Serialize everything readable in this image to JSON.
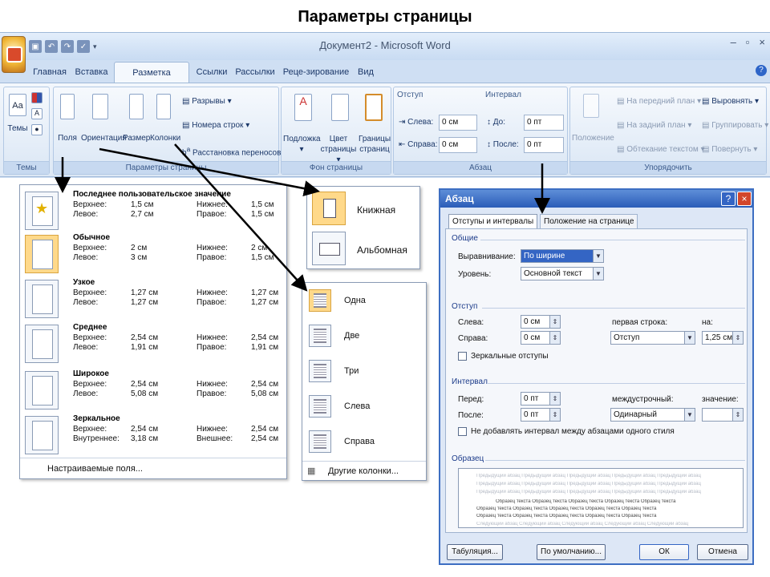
{
  "slide": {
    "title": "Параметры страницы"
  },
  "window": {
    "title": "Документ2 - Microsoft Word",
    "controls": {
      "minimize": "–",
      "restore": "▫",
      "close": "×"
    },
    "tabs": [
      "Главная",
      "Вставка",
      "Разметка страницы",
      "Ссылки",
      "Рассылки",
      "Реце-зирование",
      "Вид"
    ],
    "active_tab": "Разметка страницы",
    "help": "?"
  },
  "ribbon": {
    "themes": {
      "label": "Темы",
      "button": "Темы",
      "icon_text": "Aa"
    },
    "page_setup": {
      "label": "Параметры страницы",
      "buttons": [
        "Поля",
        "Ориентация",
        "Размер",
        "Колонки"
      ],
      "small": [
        "Разрывы",
        "Номера строк",
        "Расстановка переносов"
      ]
    },
    "page_background": {
      "label": "Фон страницы",
      "buttons": [
        "Подложка",
        "Цвет страницы",
        "Границы страниц"
      ],
      "first_word": [
        "Подложка",
        "Цвет",
        "Границы"
      ],
      "second_word": [
        "",
        "страницы",
        "страниц"
      ]
    },
    "paragraph": {
      "label": "Абзац",
      "indent_title": "Отступ",
      "spacing_title": "Интервал",
      "left_label": "Слева:",
      "right_label": "Справа:",
      "before_label": "До:",
      "after_label": "После:",
      "left_value": "0 см",
      "right_value": "0 см",
      "before_value": "0 пт",
      "after_value": "0 пт"
    },
    "arrange": {
      "label": "Упорядочить",
      "position": "Положение",
      "items": [
        "На передний план",
        "На задний план",
        "Обтекание текстом",
        "Выровнять",
        "Группировать",
        "Повернуть"
      ]
    }
  },
  "margins_menu": {
    "items": [
      {
        "name": "Последнее пользовательское значение",
        "top_label": "Верхнее:",
        "top": "1,5 см",
        "bottom_label": "Нижнее:",
        "bottom": "1,5 см",
        "left_label": "Левое:",
        "left": "2,7 см",
        "right_label": "Правое:",
        "right": "1,5 см"
      },
      {
        "name": "Обычное",
        "top_label": "Верхнее:",
        "top": "2 см",
        "bottom_label": "Нижнее:",
        "bottom": "2 см",
        "left_label": "Левое:",
        "left": "3 см",
        "right_label": "Правое:",
        "right": "1,5 см"
      },
      {
        "name": "Узкое",
        "top_label": "Верхнее:",
        "top": "1,27 см",
        "bottom_label": "Нижнее:",
        "bottom": "1,27 см",
        "left_label": "Левое:",
        "left": "1,27 см",
        "right_label": "Правое:",
        "right": "1,27 см"
      },
      {
        "name": "Среднее",
        "top_label": "Верхнее:",
        "top": "2,54 см",
        "bottom_label": "Нижнее:",
        "bottom": "2,54 см",
        "left_label": "Левое:",
        "left": "1,91 см",
        "right_label": "Правое:",
        "right": "1,91 см"
      },
      {
        "name": "Широкое",
        "top_label": "Верхнее:",
        "top": "2,54 см",
        "bottom_label": "Нижнее:",
        "bottom": "2,54 см",
        "left_label": "Левое:",
        "left": "5,08 см",
        "right_label": "Правое:",
        "right": "5,08 см"
      },
      {
        "name": "Зеркальное",
        "top_label": "Верхнее:",
        "top": "2,54 см",
        "bottom_label": "Нижнее:",
        "bottom": "2,54 см",
        "left_label": "Внутреннее:",
        "left": "3,18 см",
        "right_label": "Внешнее:",
        "right": "2,54 см"
      }
    ],
    "custom": "Настраиваемые поля..."
  },
  "orientation_menu": {
    "items": [
      "Книжная",
      "Альбомная"
    ]
  },
  "columns_menu": {
    "items": [
      "Одна",
      "Две",
      "Три",
      "Слева",
      "Справа"
    ],
    "more": "Другие колонки..."
  },
  "dialog": {
    "title": "Абзац",
    "help": "?",
    "close": "×",
    "tabs": [
      "Отступы и интервалы",
      "Положение на странице"
    ],
    "general": {
      "title": "Общие",
      "alignment_label": "Выравнивание:",
      "alignment_value": "По ширине",
      "level_label": "Уровень:",
      "level_value": "Основной текст"
    },
    "indent": {
      "title": "Отступ",
      "left_label": "Слева:",
      "left_value": "0 см",
      "right_label": "Справа:",
      "right_value": "0 см",
      "first_line_label": "первая строка:",
      "first_line_value": "Отступ",
      "by_label": "на:",
      "by_value": "1,25 см",
      "mirror_label": "Зеркальные отступы"
    },
    "spacing": {
      "title": "Интервал",
      "before_label": "Перед:",
      "before_value": "0 пт",
      "after_label": "После:",
      "after_value": "0 пт",
      "line_label": "междустрочный:",
      "line_value": "Одинарный",
      "value_label": "значение:",
      "value_value": "",
      "no_space_label": "Не добавлять интервал между абзацами одного стиля"
    },
    "sample": {
      "title": "Образец",
      "prev_text": "Предыдущий абзац Предыдущий абзац Предыдущий абзац Предыдущий абзац Предыдущий абзац",
      "sample_text": "Образец текста Образец текста Образец текста Образец текста Образец текста",
      "next_text": "Следующий абзац Следующий абзац Следующий абзац Следующий абзац Следующий абзац"
    },
    "buttons": {
      "tabs": "Табуляция...",
      "default": "По умолчанию...",
      "ok": "ОК",
      "cancel": "Отмена"
    }
  }
}
